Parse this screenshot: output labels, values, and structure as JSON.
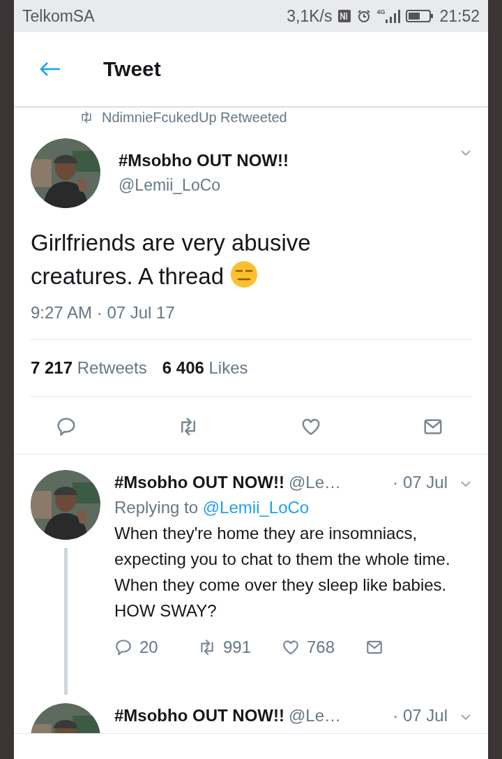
{
  "status_bar": {
    "carrier": "TelkomSA",
    "speed": "3,1K/s",
    "network": "4G",
    "time": "21:52"
  },
  "header": {
    "title": "Tweet"
  },
  "retweet_notice": "NdimnieFcukedUp Retweeted",
  "tweet": {
    "name": "#Msobho OUT NOW!!",
    "handle": "@Lemii_LoCo",
    "text": "Girlfriends are very abusive creatures. A thread",
    "timestamp": "9:27 AM · 07 Jul 17",
    "stats": [
      {
        "count": "7 217",
        "label": "Retweets"
      },
      {
        "count": "6 406",
        "label": "Likes"
      }
    ],
    "actions": [
      {
        "kind": "reply"
      },
      {
        "kind": "retweet"
      },
      {
        "kind": "like"
      },
      {
        "kind": "message"
      }
    ]
  },
  "replies": [
    {
      "name": "#Msobho OUT NOW!!",
      "handle": "@Le…",
      "date": "· 07 Jul",
      "replying_label": "Replying to",
      "replying_to": "@Lemii_LoCo",
      "text": "When they're home they are insomniacs, expecting you to chat to them the whole time. When they come over they sleep like babies. HOW SWAY?",
      "thread_line": true,
      "actions": [
        {
          "kind": "reply",
          "count": "20"
        },
        {
          "kind": "retweet",
          "count": "991"
        },
        {
          "kind": "like",
          "count": "768"
        },
        {
          "kind": "message"
        }
      ]
    },
    {
      "name": "#Msobho OUT NOW!!",
      "handle": "@Le…",
      "date": "· 07 Jul",
      "thread_line": false
    }
  ]
}
